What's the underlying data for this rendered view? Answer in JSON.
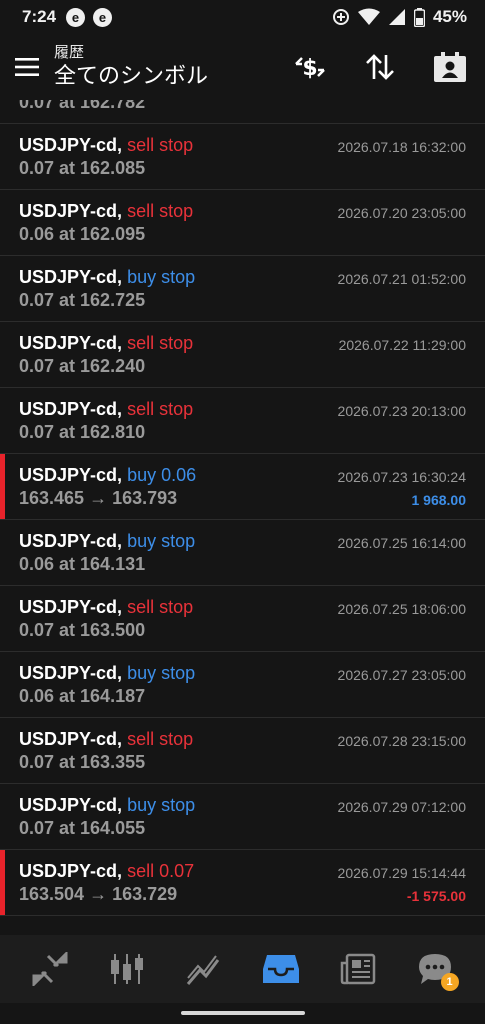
{
  "status_bar": {
    "time": "7:24",
    "notif_letter": "e",
    "battery": "45%",
    "icons": [
      "data-saver-icon",
      "wifi-icon",
      "signal-icon",
      "battery-icon"
    ]
  },
  "header": {
    "subtitle": "履歴",
    "title": "全てのシンボル",
    "icons": [
      "currency-filter-icon",
      "sort-icon",
      "account-icon"
    ]
  },
  "colors": {
    "sell": "#e8323a",
    "buy": "#3d8ee8",
    "background": "#151515",
    "active_nav": "#3d8ee8",
    "badge": "#f5a623"
  },
  "peek_row": {
    "detail": "0.07 at 162.782"
  },
  "rows": [
    {
      "symbol": "USDJPY-cd,",
      "type": "sell stop",
      "side": "sell",
      "detail": "0.07 at 162.085",
      "date": "2026.07.18 16:32:00",
      "profit": ""
    },
    {
      "symbol": "USDJPY-cd,",
      "type": "sell stop",
      "side": "sell",
      "detail": "0.06 at 162.095",
      "date": "2026.07.20 23:05:00",
      "profit": ""
    },
    {
      "symbol": "USDJPY-cd,",
      "type": "buy stop",
      "side": "buy",
      "detail": "0.07 at 162.725",
      "date": "2026.07.21 01:52:00",
      "profit": ""
    },
    {
      "symbol": "USDJPY-cd,",
      "type": "sell stop",
      "side": "sell",
      "detail": "0.07 at 162.240",
      "date": "2026.07.22 11:29:00",
      "profit": ""
    },
    {
      "symbol": "USDJPY-cd,",
      "type": "sell stop",
      "side": "sell",
      "detail": "0.07 at 162.810",
      "date": "2026.07.23 20:13:00",
      "profit": ""
    },
    {
      "symbol": "USDJPY-cd,",
      "type": "buy 0.06",
      "side": "buy",
      "detail": "163.465 → 163.793",
      "date": "2026.07.23 16:30:24",
      "profit": "1 968.00",
      "profit_sign": "pos",
      "marked": true
    },
    {
      "symbol": "USDJPY-cd,",
      "type": "buy stop",
      "side": "buy",
      "detail": "0.06 at 164.131",
      "date": "2026.07.25 16:14:00",
      "profit": ""
    },
    {
      "symbol": "USDJPY-cd,",
      "type": "sell stop",
      "side": "sell",
      "detail": "0.07 at 163.500",
      "date": "2026.07.25 18:06:00",
      "profit": ""
    },
    {
      "symbol": "USDJPY-cd,",
      "type": "buy stop",
      "side": "buy",
      "detail": "0.06 at 164.187",
      "date": "2026.07.27 23:05:00",
      "profit": ""
    },
    {
      "symbol": "USDJPY-cd,",
      "type": "sell stop",
      "side": "sell",
      "detail": "0.07 at 163.355",
      "date": "2026.07.28 23:15:00",
      "profit": ""
    },
    {
      "symbol": "USDJPY-cd,",
      "type": "buy stop",
      "side": "buy",
      "detail": "0.07 at 164.055",
      "date": "2026.07.29 07:12:00",
      "profit": ""
    },
    {
      "symbol": "USDJPY-cd,",
      "type": "sell 0.07",
      "side": "sell",
      "detail": "163.504 → 163.729",
      "date": "2026.07.29 15:14:44",
      "profit": "-1 575.00",
      "profit_sign": "neg",
      "marked": true
    }
  ],
  "bottom_nav": {
    "items": [
      "quotes-icon",
      "chart-icon",
      "trade-icon",
      "history-icon",
      "news-icon",
      "chat-icon"
    ],
    "active": "history-icon",
    "chat_badge": "1"
  }
}
